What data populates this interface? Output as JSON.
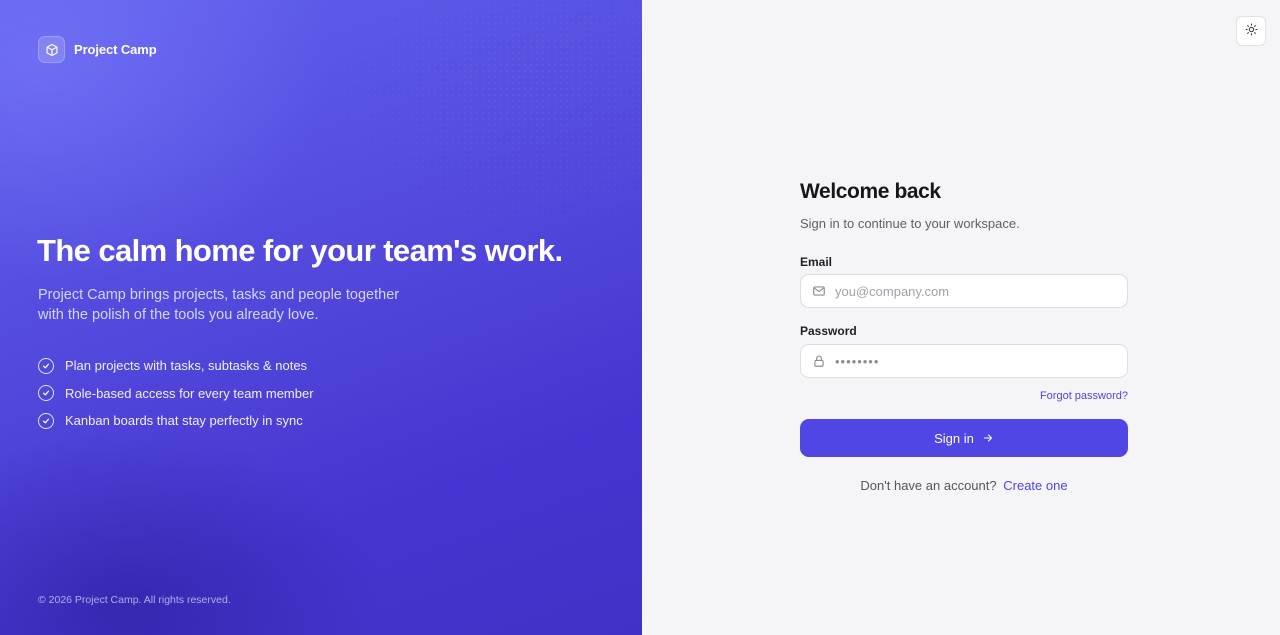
{
  "brand": {
    "name": "Project Camp",
    "logo_icon": "cube-icon"
  },
  "hero": {
    "headline": "The calm home for your team's work.",
    "tagline": "Project Camp brings projects, tasks and people together with the polish of the tools you already love.",
    "features": [
      "Plan projects with tasks, subtasks & notes",
      "Role-based access for every team member",
      "Kanban boards that stay perfectly in sync"
    ]
  },
  "footer": {
    "copyright": "© 2026 Project Camp. All rights reserved."
  },
  "theme_toggle": {
    "icon": "sun-icon"
  },
  "login": {
    "title": "Welcome back",
    "subtitle": "Sign in to continue to your workspace.",
    "email": {
      "label": "Email",
      "placeholder": "you@company.com",
      "value": "",
      "icon": "mail-icon"
    },
    "password": {
      "label": "Password",
      "value": "••••••••",
      "icon": "lock-icon"
    },
    "forgot_label": "Forgot password?",
    "submit_label": "Sign in",
    "signup_prompt": "Don't have an account?",
    "signup_link": "Create one"
  },
  "colors": {
    "accent": "#4f46e5",
    "panel_gradient_start": "#6161ee",
    "panel_gradient_end": "#3f33c6",
    "page_background": "#f5f5f7"
  }
}
